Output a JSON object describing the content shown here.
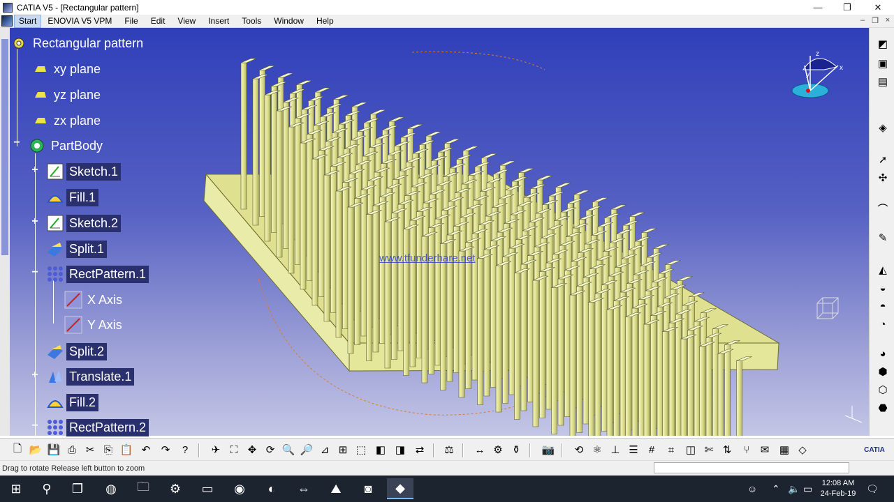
{
  "window": {
    "title": "CATIA V5 - [Rectangular pattern]",
    "minimize": "—",
    "maximize": "❐",
    "close": "✕"
  },
  "menu": {
    "items": [
      "Start",
      "ENOVIA V5 VPM",
      "File",
      "Edit",
      "View",
      "Insert",
      "Tools",
      "Window",
      "Help"
    ]
  },
  "tree": {
    "root": "Rectangular pattern",
    "planes": [
      "xy plane",
      "yz plane",
      "zx plane"
    ],
    "body": "PartBody",
    "features": [
      {
        "label": "Sketch.1",
        "icon": "sketch-icon",
        "expander": "+"
      },
      {
        "label": "Fill.1",
        "icon": "fill-icon",
        "expander": ""
      },
      {
        "label": "Sketch.2",
        "icon": "sketch-icon",
        "expander": "+"
      },
      {
        "label": "Split.1",
        "icon": "split-icon",
        "expander": ""
      },
      {
        "label": "RectPattern.1",
        "icon": "rect-pattern-icon",
        "expander": "−"
      },
      {
        "label": "X Axis",
        "icon": "axis-icon",
        "expander": ""
      },
      {
        "label": "Y Axis",
        "icon": "axis-icon",
        "expander": ""
      },
      {
        "label": "Split.2",
        "icon": "split-icon",
        "expander": ""
      },
      {
        "label": "Translate.1",
        "icon": "translate-icon",
        "expander": "+"
      },
      {
        "label": "Fill.2",
        "icon": "fill-icon",
        "expander": ""
      },
      {
        "label": "RectPattern.2",
        "icon": "rect-pattern-icon",
        "expander": "−"
      }
    ]
  },
  "viewport": {
    "watermark": "www.tfunderhare.net",
    "compass_axes": [
      "z",
      "y",
      "x"
    ]
  },
  "status": {
    "message": "Drag to rotate  Release left button to zoom"
  },
  "taskbar": {
    "time": "12:08 AM",
    "date": "24-Feb-19"
  },
  "colors": {
    "viewport_top": "#2f3fb9",
    "viewport_bottom": "#c4c6e6",
    "model_face": "#e6e8a0",
    "model_edge": "#5a5a2a",
    "taskbar": "#1c2430"
  }
}
